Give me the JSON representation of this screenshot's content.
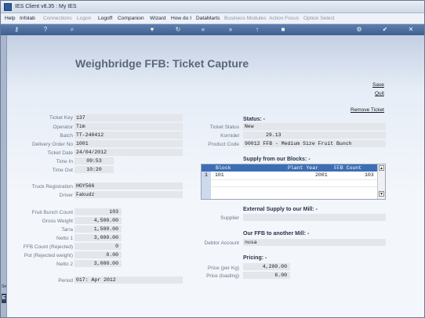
{
  "window": {
    "title": "IES Client v8.35 : My IES"
  },
  "menu": [
    {
      "label": "Help",
      "dim": false
    },
    {
      "label": "Infolab",
      "dim": false
    },
    {
      "label": "Connections",
      "dim": true
    },
    {
      "label": "Logon",
      "dim": true
    },
    {
      "label": "Logoff",
      "dim": false
    },
    {
      "label": "Companion",
      "dim": false
    },
    {
      "label": "Wizard",
      "dim": false
    },
    {
      "label": "How do I",
      "dim": false
    },
    {
      "label": "DataMarts",
      "dim": false
    },
    {
      "label": "Business Modules",
      "dim": true
    },
    {
      "label": "Action Focus",
      "dim": true
    },
    {
      "label": "Option Select",
      "dim": true
    }
  ],
  "sidebar": {
    "tag_top": "Se",
    "tag_bottom": "E"
  },
  "page": {
    "title": "Weighbridge FFB: Ticket Capture"
  },
  "actions": {
    "save": "Save",
    "quit": "Quit",
    "remove_ticket": "Remove Ticket"
  },
  "left": {
    "ticket_key_label": "Ticket Key",
    "ticket_key": "137",
    "operator_label": "Operator",
    "operator": "Tim",
    "batch_label": "Batch",
    "batch": "TT-240412",
    "delivery_order_label": "Delivery Order No",
    "delivery_order": "1001",
    "ticket_date_label": "Ticket Date",
    "ticket_date": "24/04/2012",
    "time_in_label": "Time In",
    "time_in": "09:53",
    "time_out_label": "Time Out",
    "time_out": "10:20",
    "truck_reg_label": "Truck Registration",
    "truck_reg": "HGY566",
    "driver_label": "Driver",
    "driver": "Fakudz",
    "fruit_bunch_count_label": "Fruit Bunch Count",
    "fruit_bunch_count": "103",
    "gross_weight_label": "Gross Weight",
    "gross_weight": "4,500.00",
    "tarra_label": "Tarra",
    "tarra": "1,500.00",
    "netto1_label": "Netto 1",
    "netto1": "3,000.00",
    "ffb_rejected_label": "FFB Count (Rejected)",
    "ffb_rejected": "0",
    "pot_rejected_label": "Pot (Rejected weight)",
    "pot_rejected": "0.00",
    "netto2_label": "Netto 2",
    "netto2": "3,000.00",
    "period_label": "Period",
    "period": "017: Apr 2012"
  },
  "right": {
    "status_section": "Status: -",
    "ticket_status_label": "Ticket Status",
    "ticket_status": "New",
    "kornidel_label": "Kornidel",
    "kornidel": "29.13",
    "product_code_label": "Product Code",
    "product_code": "90012 FFB - Medium Size Fruit Bunch",
    "supply_blocks_section": "Supply from our Blocks: -",
    "blocks_table": {
      "headers": [
        "Block",
        "Plant Year",
        "FFB Count"
      ],
      "rows": [
        {
          "num": "1",
          "block": "101",
          "plant_year": "2001",
          "ffb_count": "103"
        }
      ]
    },
    "external_section": "External Supply to our Mill: -",
    "supplier_label": "Supplier",
    "supplier": "",
    "ffb_other_mill_section": "Our FFB to another Mill: -",
    "debtor_label": "Debtor Account",
    "debtor": "nusa",
    "pricing_section": "Pricing: -",
    "price_kg_label": "Price (per Kg)",
    "price_kg": "4,200.00",
    "price_loading_label": "Price (loading)",
    "price_loading": "6.00"
  },
  "toolbar_icons": [
    "key-icon",
    "help-icon",
    "search-icon",
    "heart-icon",
    "refresh-icon",
    "rewind-icon",
    "forward-icon",
    "up-icon",
    "stop-icon",
    "settings-icon",
    "check-icon",
    "close-icon"
  ]
}
